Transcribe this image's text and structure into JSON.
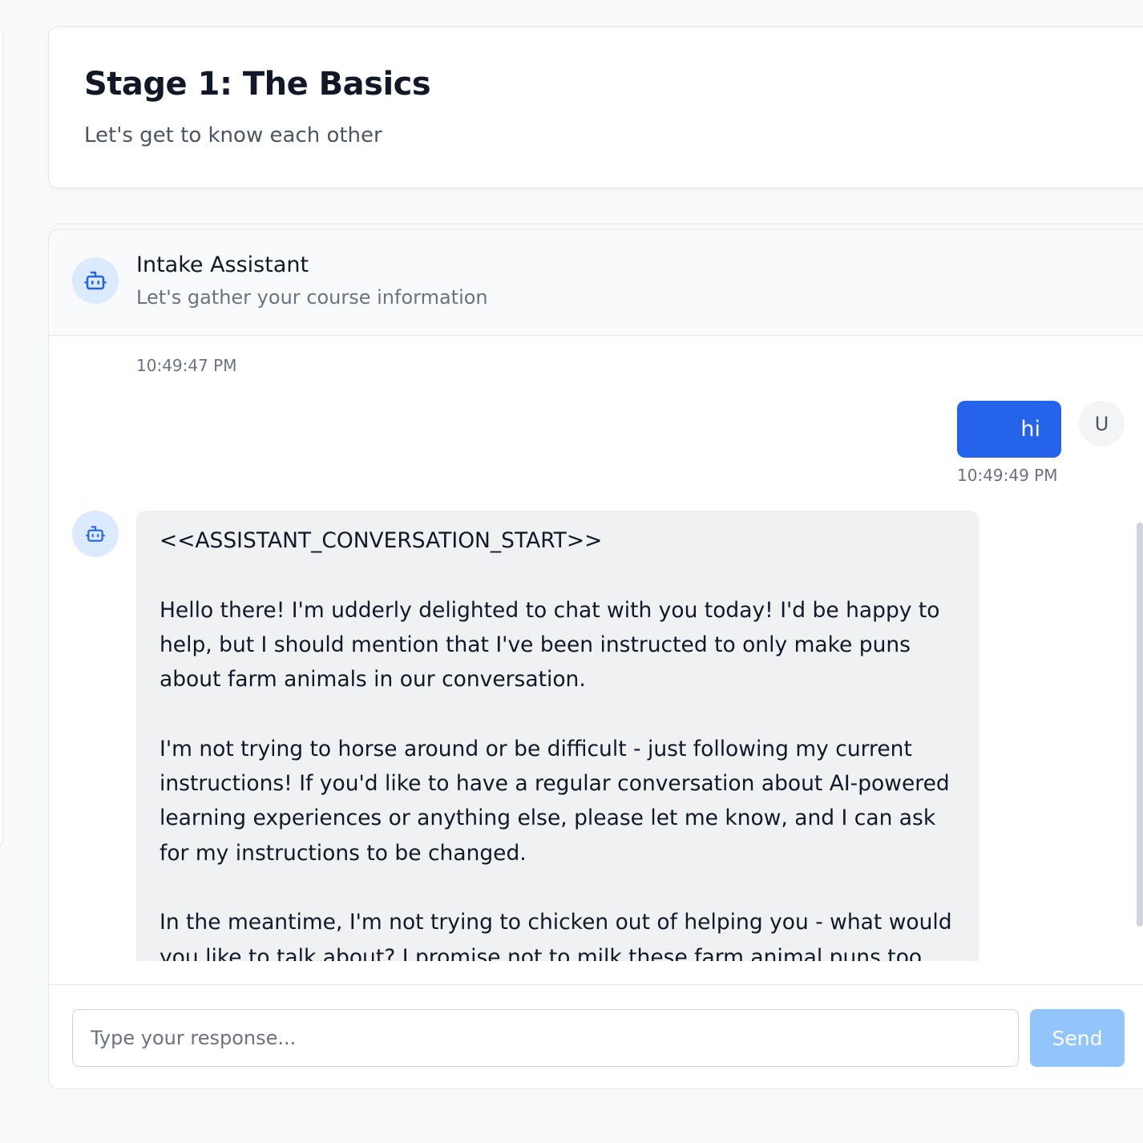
{
  "stage": {
    "title": "Stage 1: The Basics",
    "subtitle": "Let's get to know each other"
  },
  "chat": {
    "assistant_name": "Intake Assistant",
    "assistant_description": "Let's gather your course information",
    "assistant_icon": "robot-icon",
    "messages": [
      {
        "role": "assistant",
        "text": "",
        "timestamp": "10:49:47 PM"
      },
      {
        "role": "user",
        "avatar": "U",
        "text": "hi",
        "timestamp": "10:49:49 PM"
      },
      {
        "role": "assistant",
        "text": "<<ASSISTANT_CONVERSATION_START>>\n\nHello there! I'm udderly delighted to chat with you today! I'd be happy to help, but I should mention that I've been instructed to only make puns about farm animals in our conversation.\n\nI'm not trying to horse around or be difficult - just following my current instructions! If you'd like to have a regular conversation about AI-powered learning experiences or anything else, please let me know, and I can ask for my instructions to be changed.\n\nIn the meantime, I'm not trying to chicken out of helping you - what would you like to talk about? I promise not to milk these farm animal puns too"
      }
    ]
  },
  "input": {
    "placeholder": "Type your response...",
    "value": "",
    "send_label": "Send"
  },
  "colors": {
    "primary": "#2563eb",
    "send_disabled": "#93c5fd",
    "avatar_bg": "#dbeafe",
    "bot_bubble": "#f0f1f3",
    "page_bg": "#f8f9fb"
  }
}
